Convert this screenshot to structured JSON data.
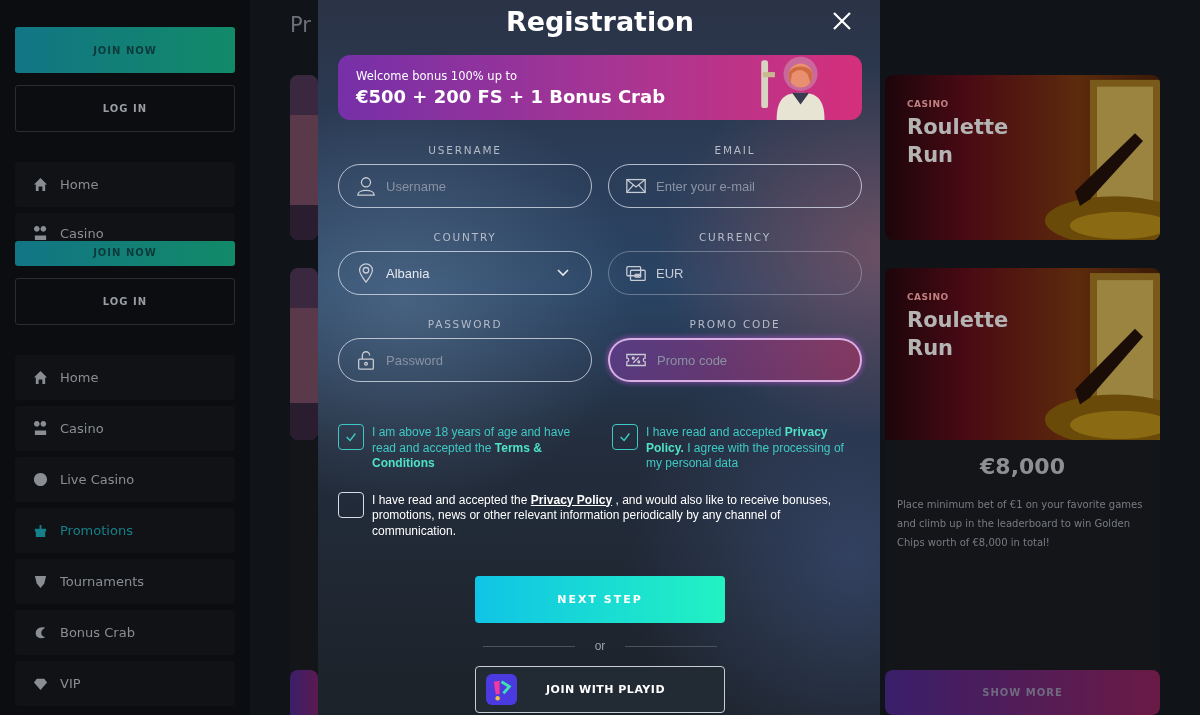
{
  "sidebar": {
    "blocks": [
      {
        "join": "JOIN NOW",
        "login": "LOG IN",
        "items": [
          {
            "label": "Home",
            "selected": false
          },
          {
            "label": "Casino",
            "selected": false
          }
        ]
      },
      {
        "join": "JOIN NOW",
        "login": "LOG IN",
        "items": [
          {
            "label": "Home",
            "selected": false
          },
          {
            "label": "Casino",
            "selected": false
          },
          {
            "label": "Live Casino",
            "selected": false
          },
          {
            "label": "Promotions",
            "selected": true
          },
          {
            "label": "Tournaments",
            "selected": false
          },
          {
            "label": "Bonus Crab",
            "selected": false
          },
          {
            "label": "VIP",
            "selected": false
          }
        ]
      }
    ]
  },
  "page": {
    "heading": "Pr",
    "cards": [
      {
        "category": "CASINO",
        "title": "Roulette Run"
      },
      {
        "category": "CASINO",
        "title": "Roulette Run",
        "prize": "€8,000",
        "description": "Place minimum bet of €1 on your favorite games and climb up in the leaderboard to win Golden Chips worth of €8,000 in total!",
        "button": "SHOW MORE"
      }
    ]
  },
  "modal": {
    "title": "Registration",
    "banner": {
      "subtitle": "Welcome bonus 100% up to",
      "headline": "€500 + 200 FS + 1 Bonus Crab"
    },
    "fields": [
      {
        "label": "USERNAME",
        "kind": "input",
        "placeholder": "Username",
        "focused": false,
        "disabled": false
      },
      {
        "label": "EMAIL",
        "kind": "input",
        "placeholder": "Enter your e-mail",
        "focused": false,
        "disabled": false
      },
      {
        "label": "COUNTRY",
        "kind": "select",
        "value": "Albania",
        "focused": false,
        "disabled": false
      },
      {
        "label": "CURRENCY",
        "kind": "input",
        "value": "EUR",
        "focused": false,
        "disabled": true
      },
      {
        "label": "PASSWORD",
        "kind": "input",
        "placeholder": "Password",
        "focused": false,
        "disabled": false
      },
      {
        "label": "PROMO CODE",
        "kind": "input",
        "placeholder": "Promo code",
        "focused": true,
        "disabled": false
      }
    ],
    "consents": [
      {
        "checked": true,
        "parts": [
          {
            "kind": "text",
            "text": "I am above 18 years of age and have read and accepted the **Terms & Conditions**"
          }
        ]
      },
      {
        "checked": true,
        "parts": [
          {
            "kind": "text",
            "text": "I have read and accepted **Privacy Policy.** I agree with the processing of my personal data"
          }
        ]
      },
      {
        "checked": false,
        "parts": [
          {
            "kind": "text",
            "text": "I have read and accepted the "
          },
          {
            "kind": "link",
            "text": "Privacy Policy"
          },
          {
            "kind": "text",
            "text": " , and would also like to receive bonuses, promotions, news or other relevant information periodically by any channel of communication."
          }
        ]
      }
    ],
    "next_button": "NEXT STEP",
    "divider": "or",
    "playid_button": "JOIN WITH PLAYID"
  }
}
